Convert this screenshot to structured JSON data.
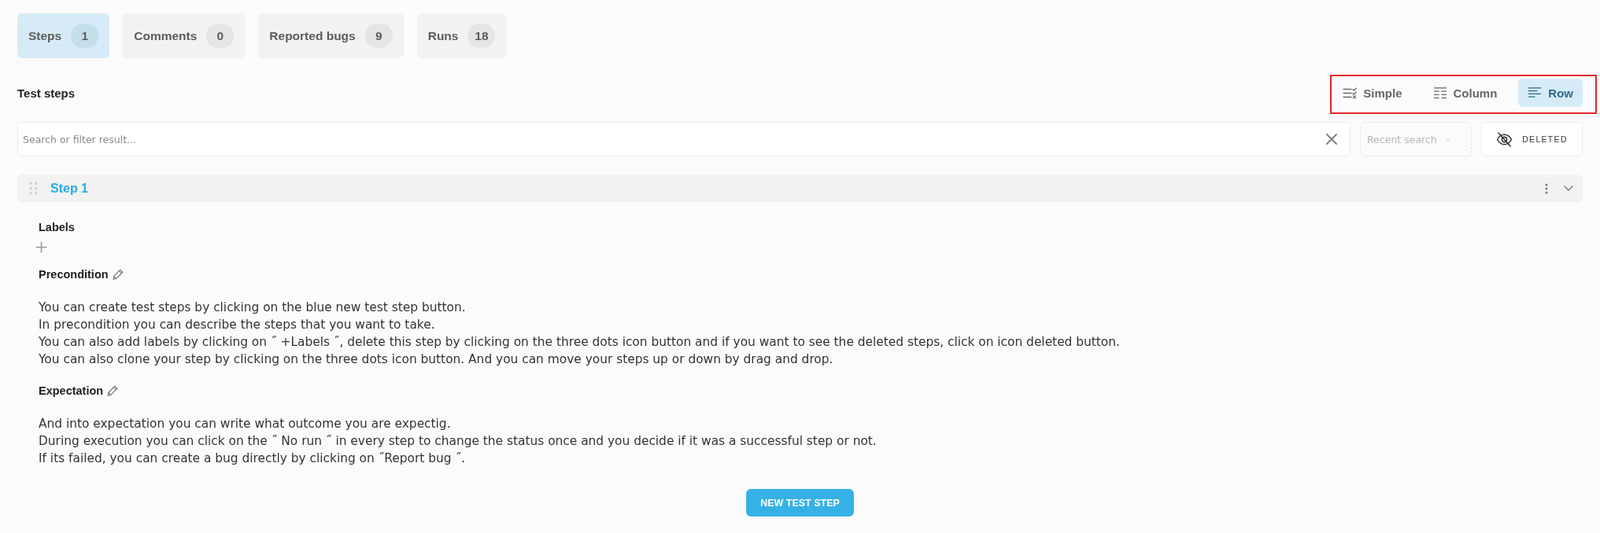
{
  "tabs": [
    {
      "label": "Steps",
      "count": "1",
      "selected": true
    },
    {
      "label": "Comments",
      "count": "0",
      "selected": false
    },
    {
      "label": "Reported bugs",
      "count": "9",
      "selected": false
    },
    {
      "label": "Runs",
      "count": "18",
      "selected": false
    }
  ],
  "section": {
    "title": "Test steps"
  },
  "view_switch": {
    "highlighted": true,
    "modes": [
      {
        "label": "Simple",
        "kind": "simple",
        "selected": false
      },
      {
        "label": "Column",
        "kind": "column",
        "selected": false
      },
      {
        "label": "Row",
        "kind": "row",
        "selected": true
      }
    ]
  },
  "filter": {
    "search": {
      "placeholder": "Search or filter result..."
    },
    "recent_search": {
      "placeholder": "Recent search"
    },
    "deleted_button": "DELETED"
  },
  "steps": [
    {
      "title": "Step 1",
      "expanded": true,
      "labels_title": "Labels",
      "fields": [
        {
          "title": "Precondition",
          "lines": [
            "You can create test steps by clicking on the blue new test step button.",
            "In precondition you can describe the steps that you want to take.",
            "You can also add labels by clicking on ˝ +Labels ˝, delete this step by clicking on the three dots icon button and if you want to see the deleted steps, click on icon deleted button.",
            "You can also clone your step by clicking on the three dots icon button. And you can move your steps up or down by drag and drop."
          ]
        },
        {
          "title": "Expectation",
          "lines": [
            "And into expectation you can write what outcome you are expectig.",
            "During execution you can click on the ˝ No run ˝ in every step to change the status once and you decide if it was a successful step or not.",
            "If its failed, you can create a bug directly by clicking on ˝Report bug ˝."
          ]
        }
      ]
    }
  ],
  "new_step_button": "NEW TEST STEP"
}
